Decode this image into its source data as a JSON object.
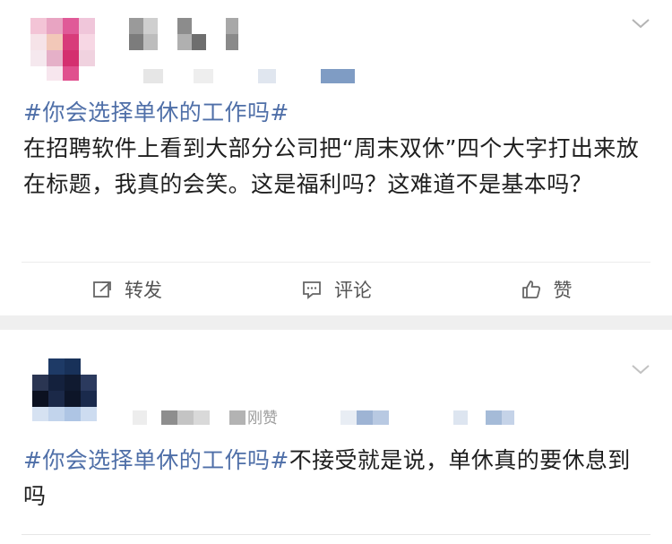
{
  "posts": [
    {
      "hashtag": "#你会选择单休的工作吗#",
      "body": "在招聘软件上看到大部分公司把“周末双休”四个大字打出来放在标题，我真的会笑。这是福利吗？这难道不是基本吗？",
      "line2": "打出来放在标题，我真的会笑。这是福利吗？这难道",
      "actions": {
        "repost": "转发",
        "comment": "评论",
        "like": "赞"
      }
    },
    {
      "hashtag": "#你会选择单休的工作吗#",
      "body": "不接受就是说，单休真的要休息到吗",
      "line2": "休息到吗",
      "faint_label": "刚赞"
    }
  ],
  "icons": {
    "chevron": "chevron-down-icon",
    "repost": "repost-icon",
    "comment": "comment-icon",
    "like": "thumbs-up-icon"
  },
  "colors": {
    "hashtag": "#4f6fa8",
    "separator": "#efefef",
    "action_text": "#555555"
  }
}
